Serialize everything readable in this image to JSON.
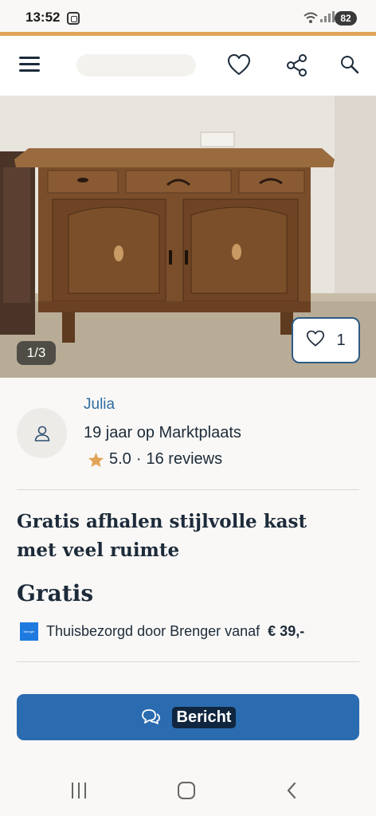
{
  "status_bar": {
    "time": "13:52",
    "battery": "82"
  },
  "nav": {
    "menu_icon": "hamburger-icon",
    "favorite_icon": "heart-icon",
    "share_icon": "share-icon",
    "search_icon": "search-icon"
  },
  "listing": {
    "photo_counter": "1/3",
    "favorite_count": "1",
    "title": "Gratis afhalen stijlvolle kast met veel ruimte",
    "price": "Gratis"
  },
  "seller": {
    "name": "Julia",
    "membership": "19 jaar op Marktplaats",
    "rating": "5.0",
    "separator": "·",
    "reviews": "16 reviews"
  },
  "delivery": {
    "logo_text": "brenger",
    "text": "Thuisbezorgd door Brenger vanaf",
    "price": "€ 39,-"
  },
  "actions": {
    "message_label": "Bericht"
  },
  "colors": {
    "accent": "#e1a458",
    "link": "#2e6ba3",
    "button": "#2b6cb0",
    "text": "#1d2b3a",
    "star": "#e1a458"
  }
}
